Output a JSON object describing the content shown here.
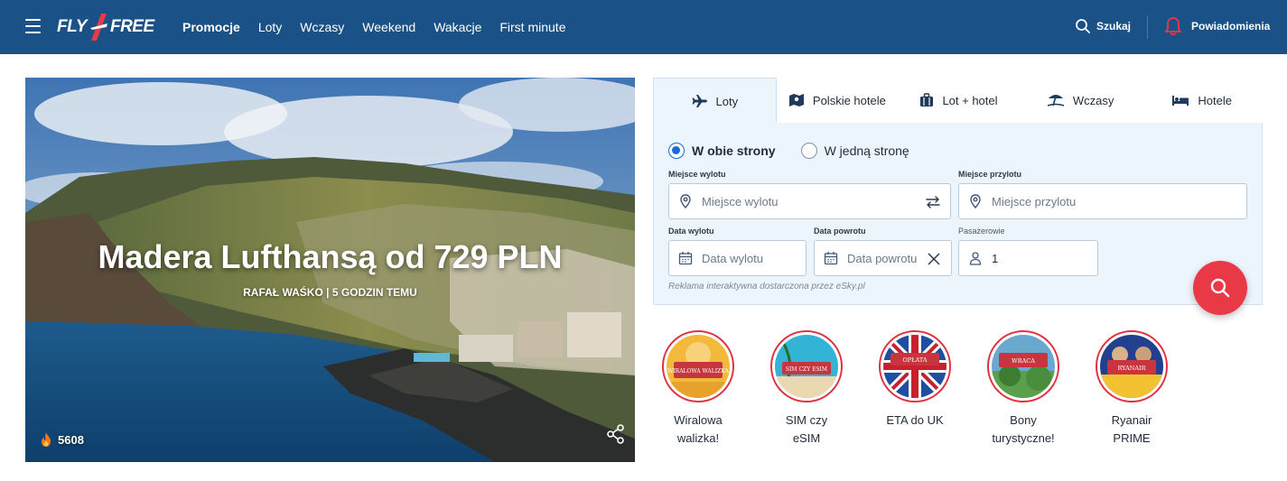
{
  "header": {
    "logo_left": "FLY",
    "logo_right": "FREE",
    "nav": [
      "Promocje",
      "Loty",
      "Wczasy",
      "Weekend",
      "Wakacje",
      "First minute"
    ],
    "active_nav": "Promocje",
    "search_label": "Szukaj",
    "notifications_label": "Powiadomienia",
    "colors": {
      "bar": "#1a5186",
      "accent": "#ea3946"
    }
  },
  "hero": {
    "title": "Madera Lufthansą od 729 PLN",
    "meta": "RAFAŁ WAŚKO | 5 GODZIN TEMU",
    "views": "5608",
    "share_icon": "share-icon",
    "views_icon": "fire-icon"
  },
  "booking": {
    "tabs": [
      {
        "label": "Loty",
        "icon": "plane-icon",
        "active": true
      },
      {
        "label": "Polskie hotele",
        "icon": "map-icon",
        "active": false
      },
      {
        "label": "Lot + hotel",
        "icon": "suitcase-icon",
        "active": false
      },
      {
        "label": "Wczasy",
        "icon": "beach-icon",
        "active": false
      },
      {
        "label": "Hotele",
        "icon": "bed-icon",
        "active": false
      }
    ],
    "trip_types": [
      {
        "label": "W obie strony",
        "selected": true
      },
      {
        "label": "W jedną stronę",
        "selected": false
      }
    ],
    "from": {
      "label": "Miejsce wylotu",
      "placeholder": "Miejsce wylotu"
    },
    "to": {
      "label": "Miejsce przylotu",
      "placeholder": "Miejsce przylotu"
    },
    "depart": {
      "label": "Data wylotu",
      "placeholder": "Data wylotu"
    },
    "return": {
      "label": "Data powrotu",
      "placeholder": "Data powrotu"
    },
    "passengers": {
      "label": "Pasażerowie",
      "value": "1"
    },
    "ad_note": "Reklama interaktywna dostarczona przez eSky.pl"
  },
  "stories": [
    {
      "label": "Wiralowa walizka!",
      "badge": "WIRALOWA WALIZKA",
      "theme": "#f2b93b"
    },
    {
      "label": "SIM czy eSIM",
      "badge": "SIM CZY ESIM",
      "theme": "#33b3d6"
    },
    {
      "label": "ETA do UK",
      "badge": "OPŁATA",
      "theme": "#1e4fa0"
    },
    {
      "label": "Bony turystyczne!",
      "badge": "WRACA",
      "theme": "#5aa04a"
    },
    {
      "label": "Ryanair PRIME",
      "badge": "RYANAIR",
      "theme": "#23408e"
    }
  ]
}
